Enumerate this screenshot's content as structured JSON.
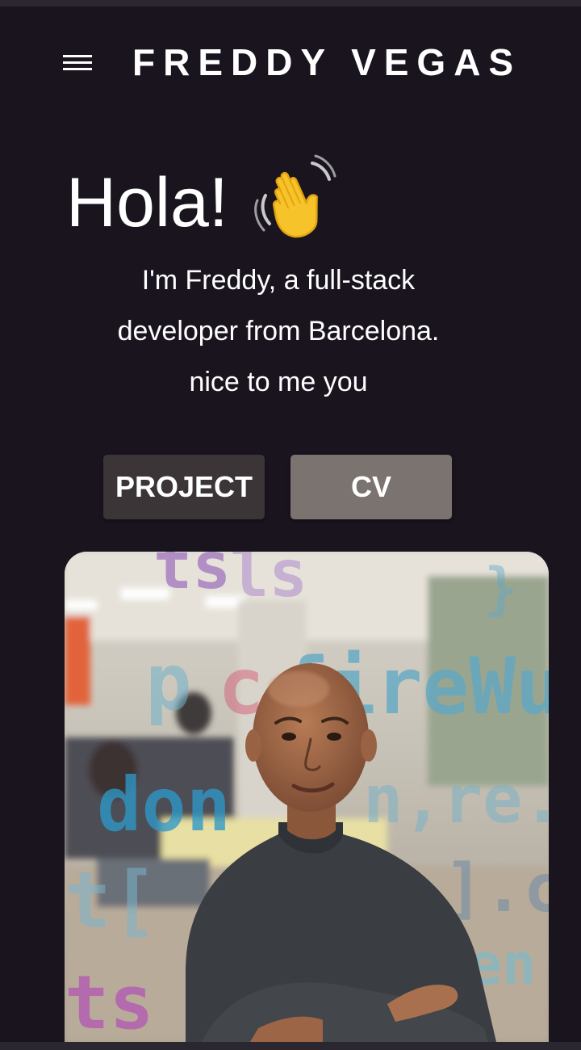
{
  "header": {
    "brand": "FREDDY VEGAS",
    "menu_icon": "hamburger-menu-icon"
  },
  "hero": {
    "title": "Hola!",
    "emoji_icon": "waving-hand-icon",
    "intro_lines": [
      "I'm Freddy, a full-stack",
      "developer from Barcelona.",
      "nice to me you"
    ]
  },
  "actions": {
    "project_label": "PROJECT",
    "cv_label": "CV"
  },
  "photo": {
    "subject": "portrait-photo"
  },
  "colors": {
    "background": "#1a141e",
    "text": "#ffffff",
    "project_button": "#3b3538",
    "cv_button": "#7a7370",
    "wave_yellow": "#f7c32b"
  }
}
